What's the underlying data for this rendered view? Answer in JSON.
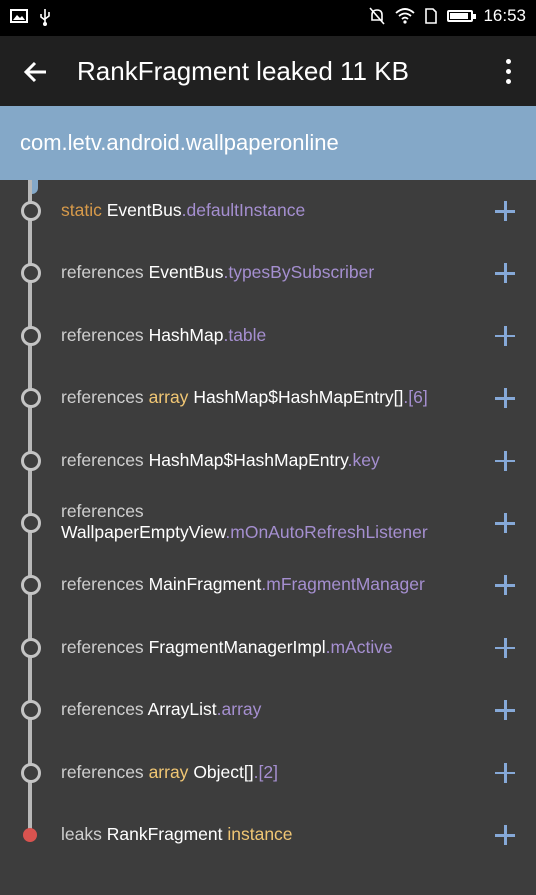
{
  "status_bar": {
    "time": "16:53",
    "left_icons": [
      "image-icon",
      "usb-icon"
    ],
    "right_icons": [
      "mute-icon",
      "wifi-icon",
      "sim-icon",
      "battery-icon"
    ]
  },
  "app_bar": {
    "title": "RankFragment leaked 11 KB",
    "back_icon": "back-arrow-icon",
    "menu_icon": "more-vert-icon"
  },
  "header": {
    "package": "com.letv.android.wallpaperonline"
  },
  "colors": {
    "background": "#3d3d3d",
    "header": "#84a8c8",
    "static_keyword": "#d79a4a",
    "array_keyword": "#f0c674",
    "field": "#a58fd0",
    "plus": "#86a9d8",
    "leak_node": "#d9534f"
  },
  "trace": [
    {
      "prefix": "static",
      "type": "",
      "cls": "EventBus",
      "field": ".defaultInstance"
    },
    {
      "prefix": "references",
      "type": "",
      "cls": "EventBus",
      "field": ".typesBySubscriber"
    },
    {
      "prefix": "references",
      "type": "",
      "cls": "HashMap",
      "field": ".table"
    },
    {
      "prefix": "references",
      "type": "array",
      "cls": "HashMap$HashMapEntry[]",
      "field": ".[6]"
    },
    {
      "prefix": "references",
      "type": "",
      "cls": "HashMap$HashMapEntry",
      "field": ".key"
    },
    {
      "prefix": "references",
      "type": "",
      "cls": "WallpaperEmptyView",
      "field": ".mOnAutoRefreshListener"
    },
    {
      "prefix": "references",
      "type": "",
      "cls": "MainFragment",
      "field": ".mFragmentManager"
    },
    {
      "prefix": "references",
      "type": "",
      "cls": "FragmentManagerImpl",
      "field": ".mActive"
    },
    {
      "prefix": "references",
      "type": "",
      "cls": "ArrayList",
      "field": ".array"
    },
    {
      "prefix": "references",
      "type": "array",
      "cls": "Object[]",
      "field": ".[2]"
    },
    {
      "prefix": "leaks",
      "type": "",
      "cls": "RankFragment",
      "field": "instance"
    }
  ]
}
